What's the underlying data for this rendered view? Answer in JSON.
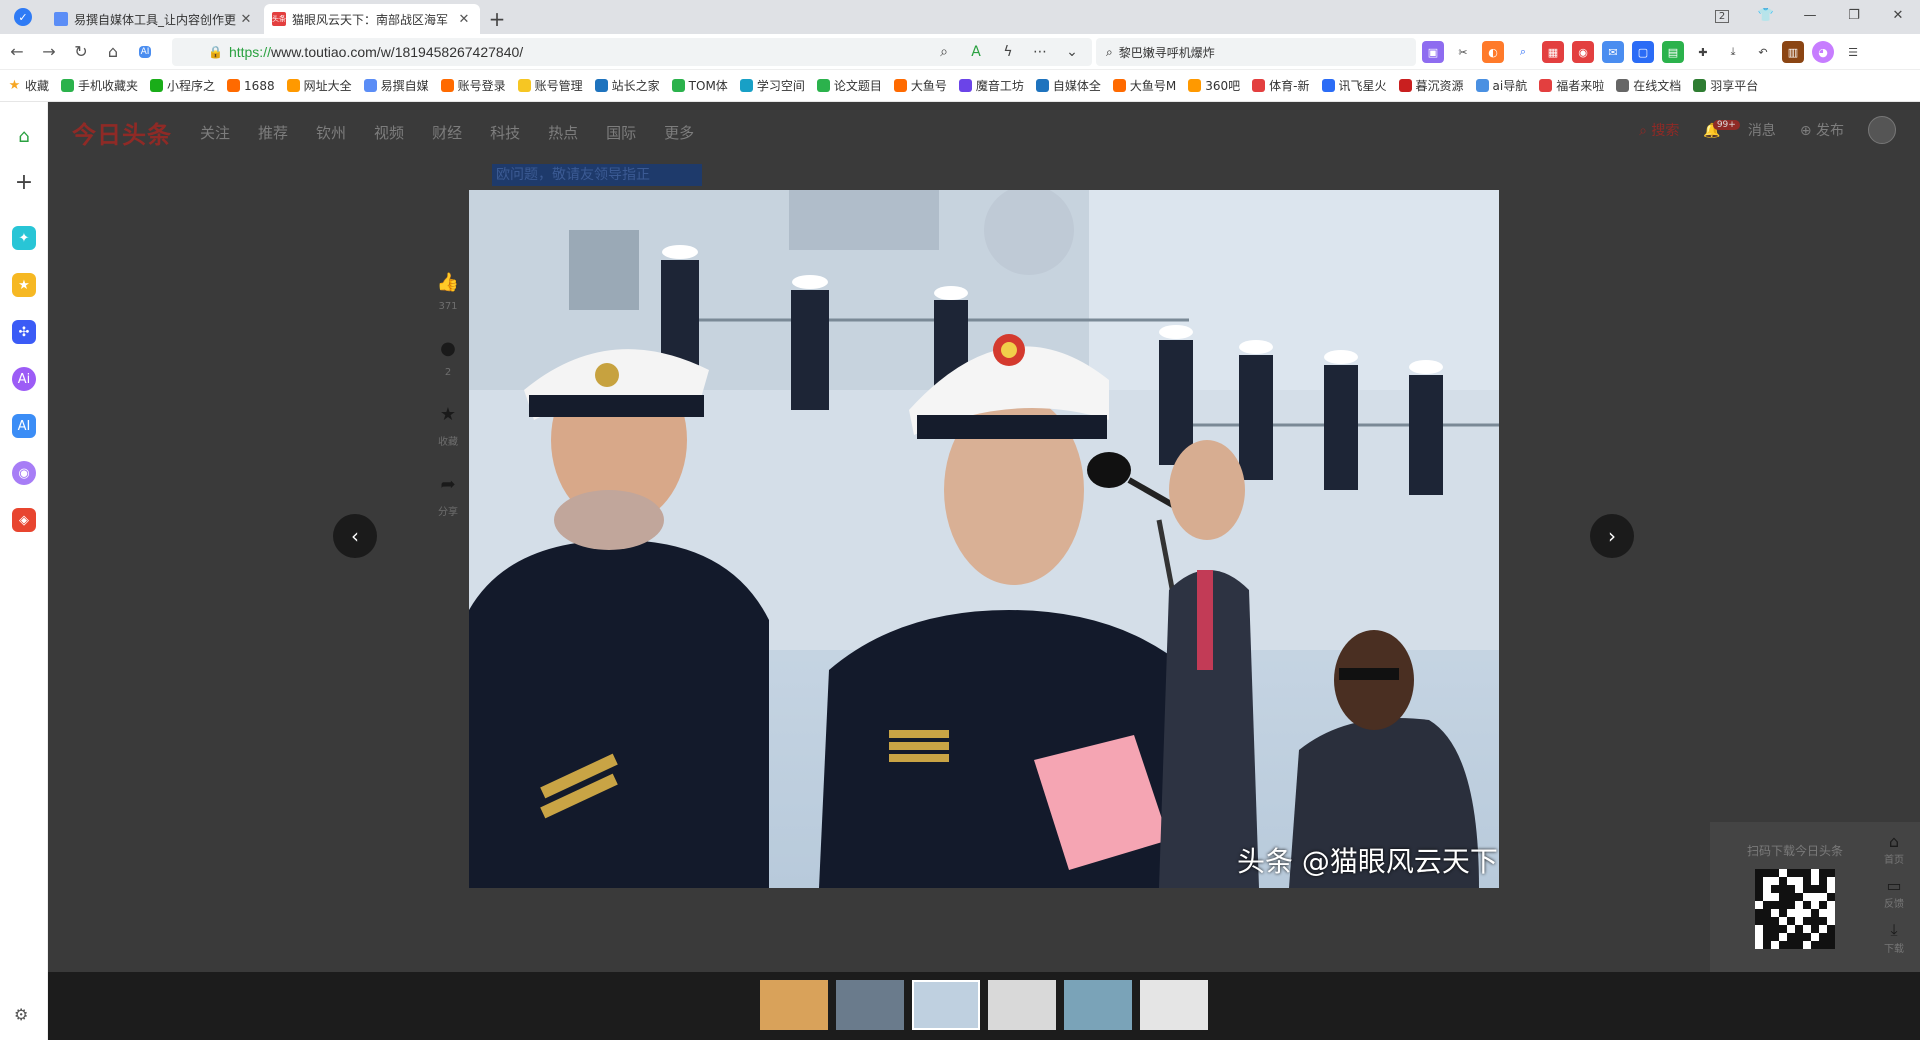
{
  "tabs": [
    {
      "title": "易撰自媒体工具_让内容创作更",
      "close": "✕",
      "favicon_color": "#5b8df6",
      "active": false
    },
    {
      "title": "猫眼风云天下：南部战区海军",
      "close": "✕",
      "favicon_color": "#e33f3f",
      "favicon_text": "头条",
      "active": true
    }
  ],
  "window_badge": "2",
  "address": {
    "protocol": "https://",
    "host": "www.toutiao.com/w/1819458267427840/"
  },
  "search": {
    "value": "黎巴嫩寻呼机爆炸"
  },
  "bookmarks": [
    {
      "label": "收藏",
      "color": "#f6a623",
      "icon": "★"
    },
    {
      "label": "手机收藏夹",
      "color": "#2bb24c"
    },
    {
      "label": "小程序之",
      "color": "#1aad19"
    },
    {
      "label": "1688",
      "color": "#ff6a00"
    },
    {
      "label": "网址大全",
      "color": "#ff9900"
    },
    {
      "label": "易撰自媒",
      "color": "#5b8df6"
    },
    {
      "label": "账号登录",
      "color": "#ff6a00"
    },
    {
      "label": "账号管理",
      "color": "#f6c623"
    },
    {
      "label": "站长之家",
      "color": "#1e73be"
    },
    {
      "label": "TOM体",
      "color": "#2bb24c"
    },
    {
      "label": "学习空间",
      "color": "#18a0c6"
    },
    {
      "label": "论文题目",
      "color": "#2bb24c"
    },
    {
      "label": "大鱼号",
      "color": "#ff6a00"
    },
    {
      "label": "魔音工坊",
      "color": "#6b44e8"
    },
    {
      "label": "自媒体全",
      "color": "#1e73be"
    },
    {
      "label": "大鱼号M",
      "color": "#ff6a00"
    },
    {
      "label": "360吧",
      "color": "#ff9900"
    },
    {
      "label": "体育-新",
      "color": "#e33f3f"
    },
    {
      "label": "讯飞星火",
      "color": "#2b6cf6"
    },
    {
      "label": "暮沉资源",
      "color": "#c91f1f"
    },
    {
      "label": "ai导航",
      "color": "#4a90e2"
    },
    {
      "label": "福者来啦",
      "color": "#e33f3f"
    },
    {
      "label": "在线文档",
      "color": "#666666"
    },
    {
      "label": "羽享平台",
      "color": "#2e7d32"
    }
  ],
  "site": {
    "logo": "今日头条",
    "nav": [
      "关注",
      "推荐",
      "钦州",
      "视频",
      "财经",
      "科技",
      "热点",
      "国际",
      "更多"
    ],
    "search_label": "搜索",
    "messages_label": "消息",
    "messages_badge": "99+",
    "publish_label": "发布",
    "caption_fragment": "欧问题，敬请友领导指正"
  },
  "actions": {
    "like_count": "371",
    "comment_count": "2",
    "collect_label": "收藏",
    "share_label": "分享"
  },
  "photo": {
    "watermark": "头条 @猫眼风云天下"
  },
  "right_panel": {
    "qr_title": "扫码下载今日头条",
    "home_label": "首页",
    "feedback_label": "反馈",
    "download_label": "下载"
  },
  "thumbnails_count": 6,
  "active_thumbnail": 3
}
